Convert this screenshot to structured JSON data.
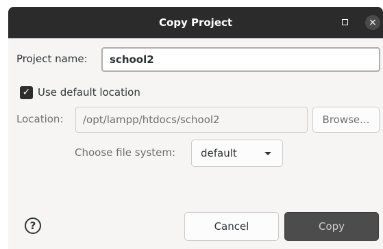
{
  "window": {
    "title": "Copy Project",
    "maximize_icon": "maximize-icon",
    "close_glyph": "×"
  },
  "form": {
    "project_name_label": "Project name:",
    "project_name_value": "school2",
    "use_default_location_label": "Use default location",
    "use_default_location_checked": true,
    "location_label": "Location:",
    "location_value": "/opt/lampp/htdocs/school2",
    "browse_label": "Browse...",
    "file_system_label": "Choose file system:",
    "file_system_value": "default"
  },
  "footer": {
    "help_glyph": "?",
    "cancel_label": "Cancel",
    "copy_label": "Copy"
  },
  "colors": {
    "titlebar": "#2b2b2b",
    "dialog_bg": "#f6f5f4",
    "primary_button": "#4c4c4c"
  }
}
